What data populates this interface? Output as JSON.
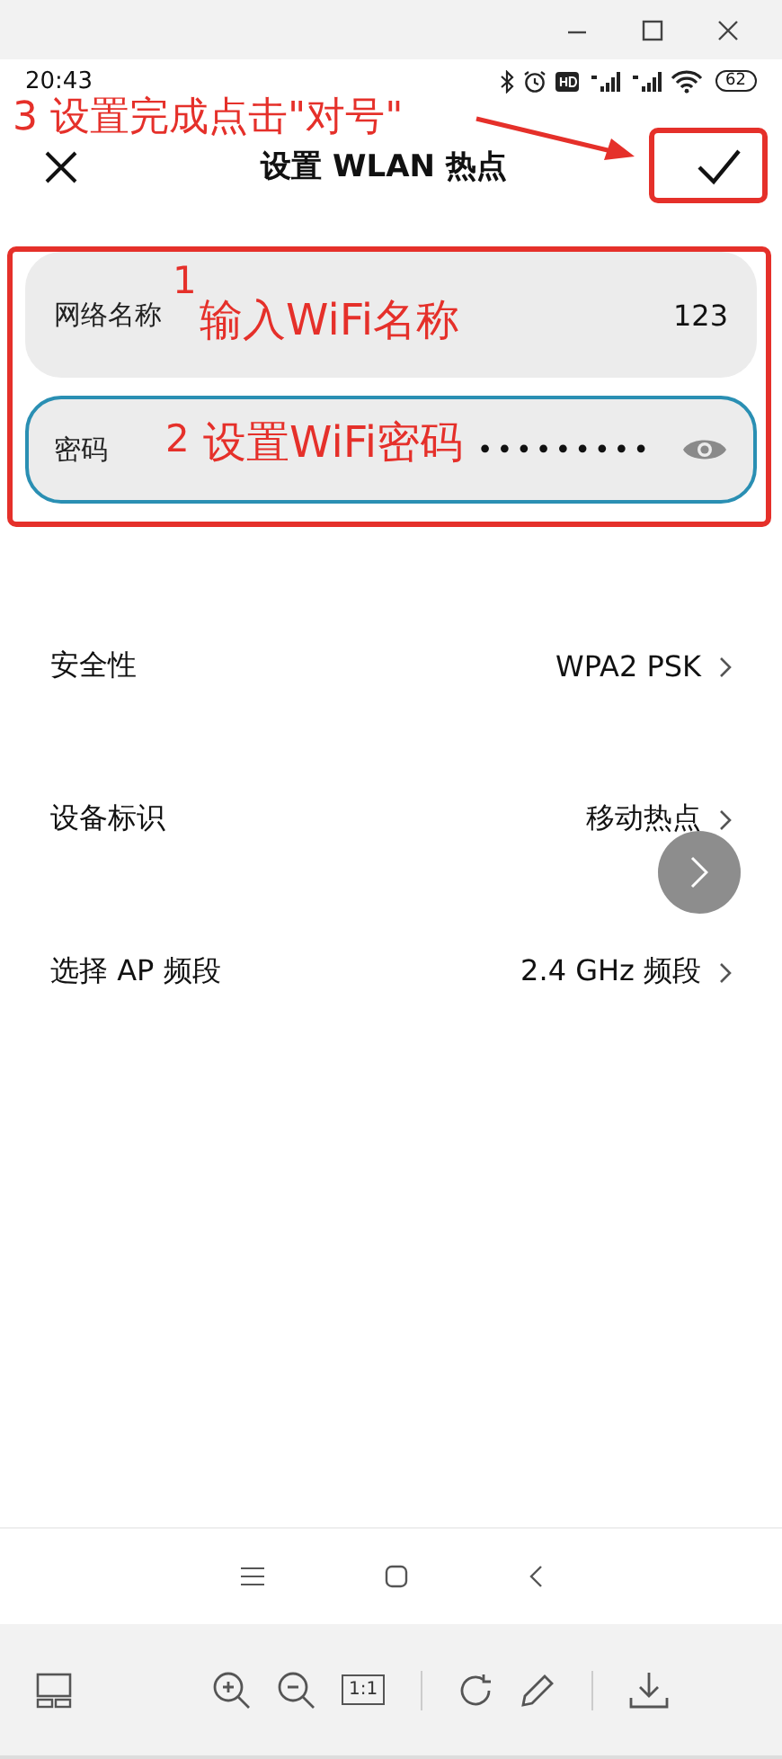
{
  "status_bar": {
    "time": "20:43",
    "battery": "62"
  },
  "header": {
    "title": "设置 WLAN 热点"
  },
  "fields": [
    {
      "kind": "text",
      "label": "网络名称",
      "value": "123",
      "focused": false
    },
    {
      "kind": "password",
      "label": "密码",
      "value": "•••••••••",
      "focused": true
    }
  ],
  "settings": [
    {
      "label": "安全性",
      "value": "WPA2 PSK"
    },
    {
      "label": "设备标识",
      "value": "移动热点"
    },
    {
      "label": "选择 AP 频段",
      "value": "2.4 GHz 频段"
    }
  ],
  "viewer_toolbar": {
    "actual_size": "1:1"
  },
  "annotations": [
    {
      "kind": "step",
      "text": "3 设置完成点击\"对号\""
    },
    {
      "kind": "number",
      "text": "1"
    },
    {
      "kind": "caption",
      "text": "输入WiFi名称"
    },
    {
      "kind": "number",
      "text": "2"
    },
    {
      "kind": "caption",
      "text": "设置WiFi密码"
    }
  ]
}
